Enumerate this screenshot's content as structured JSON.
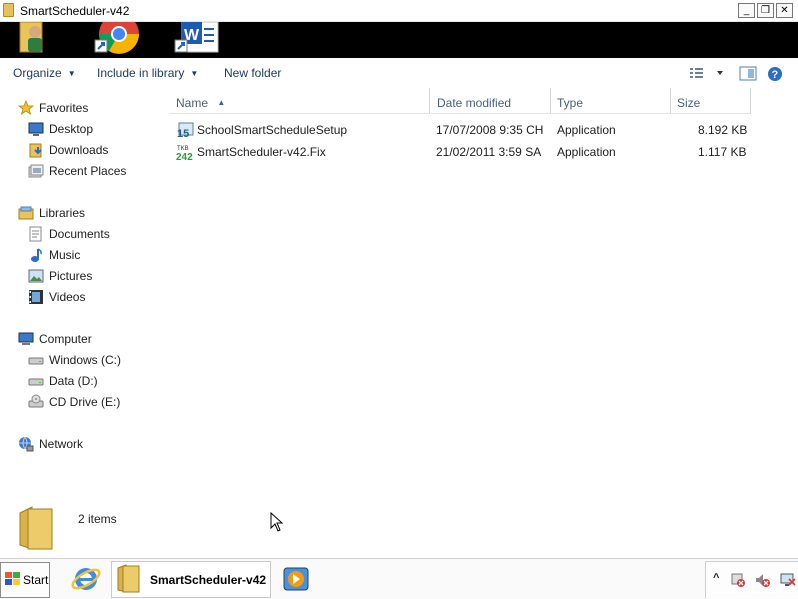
{
  "window": {
    "title": "SmartScheduler-v42",
    "minimize_glyph": "_",
    "restore_glyph": "❐",
    "close_glyph": "✕"
  },
  "launcher": {
    "icons": [
      "user-folder-icon",
      "chrome-icon",
      "word-icon"
    ]
  },
  "toolbar": {
    "organize": "Organize",
    "include_in_library": "Include in library",
    "new_folder": "New folder",
    "icons": [
      "view-options-icon",
      "preview-pane-icon",
      "help-icon"
    ]
  },
  "nav": {
    "favorites": {
      "label": "Favorites",
      "items": [
        "Desktop",
        "Downloads",
        "Recent Places"
      ]
    },
    "libraries": {
      "label": "Libraries",
      "items": [
        "Documents",
        "Music",
        "Pictures",
        "Videos"
      ]
    },
    "computer": {
      "label": "Computer",
      "items": [
        "Windows (C:)",
        "Data (D:)",
        "CD Drive (E:)"
      ]
    },
    "network": {
      "label": "Network"
    }
  },
  "columns": {
    "name": "Name",
    "date_modified": "Date modified",
    "type": "Type",
    "size": "Size",
    "sort_glyph": "▲"
  },
  "files": [
    {
      "name": "SchoolSmartScheduleSetup",
      "date": "17/07/2008 9:35 CH",
      "type": "Application",
      "size": "8.192 KB",
      "icon": "setup-app-icon"
    },
    {
      "name": "SmartScheduler-v42.Fix",
      "date": "21/02/2011 3:59 SA",
      "type": "Application",
      "size": "1.117 KB",
      "icon": "smartscheduler-app-icon"
    }
  ],
  "details": {
    "count": "2 items"
  },
  "taskbar": {
    "start": "Start",
    "active_window": "SmartScheduler-v42",
    "tray_expand_glyph": "^"
  },
  "colors": {
    "accent_text": "#1e395b",
    "header_text": "#4c607a",
    "folder_yellow": "#e8c45a"
  }
}
